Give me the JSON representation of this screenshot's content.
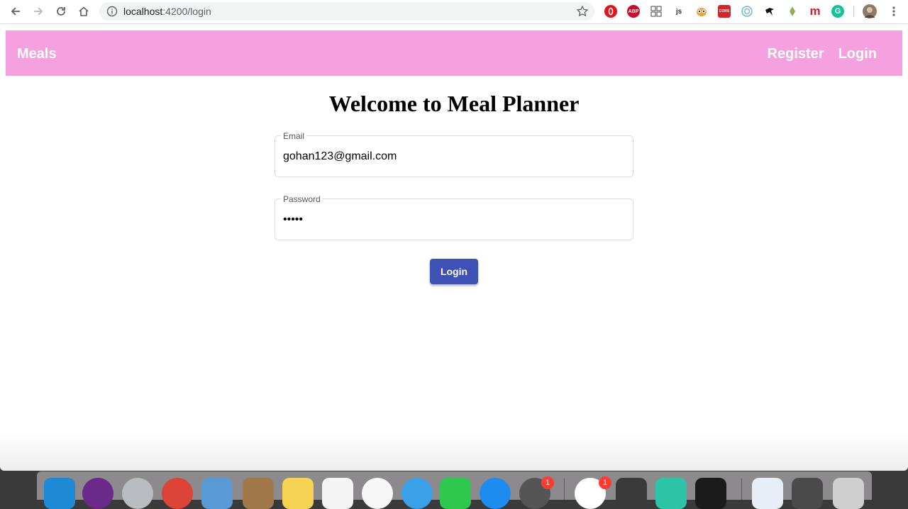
{
  "browser": {
    "url_host": "localhost",
    "url_path": ":4200/login",
    "extensions": [
      {
        "name": "opera-vpn-icon",
        "color": "#e0141b",
        "label": ""
      },
      {
        "name": "adblock-plus-icon",
        "color": "#c70d2c",
        "label": "ABP"
      },
      {
        "name": "grid-icon",
        "color": "#ffffff",
        "label": ""
      },
      {
        "name": "js-icon",
        "color": "#ffffff",
        "label": "js"
      },
      {
        "name": "owl-icon",
        "color": "#f0c04a",
        "label": ""
      },
      {
        "name": "cors-icon",
        "color": "#d0272d",
        "label": "CORS"
      },
      {
        "name": "target-icon",
        "color": "#5fc8a8",
        "label": ""
      },
      {
        "name": "bird-icon",
        "color": "#ffffff",
        "label": ""
      },
      {
        "name": "leaf-icon",
        "color": "#ffffff",
        "label": ""
      },
      {
        "name": "m-icon",
        "color": "#ffffff",
        "label": "m"
      },
      {
        "name": "grammarly-icon",
        "color": "#15c39a",
        "label": "G"
      }
    ]
  },
  "navbar": {
    "brand": "Meals",
    "links": [
      "Register",
      "Login"
    ],
    "background": "#f5a1df"
  },
  "page": {
    "title": "Welcome to Meal Planner"
  },
  "form": {
    "email_label": "Email",
    "email_value": "gohan123@gmail.com",
    "password_label": "Password",
    "password_value": "•••••",
    "submit_label": "Login",
    "submit_color": "#3f51b5"
  },
  "dock": {
    "badges": [
      "1",
      "1"
    ]
  }
}
